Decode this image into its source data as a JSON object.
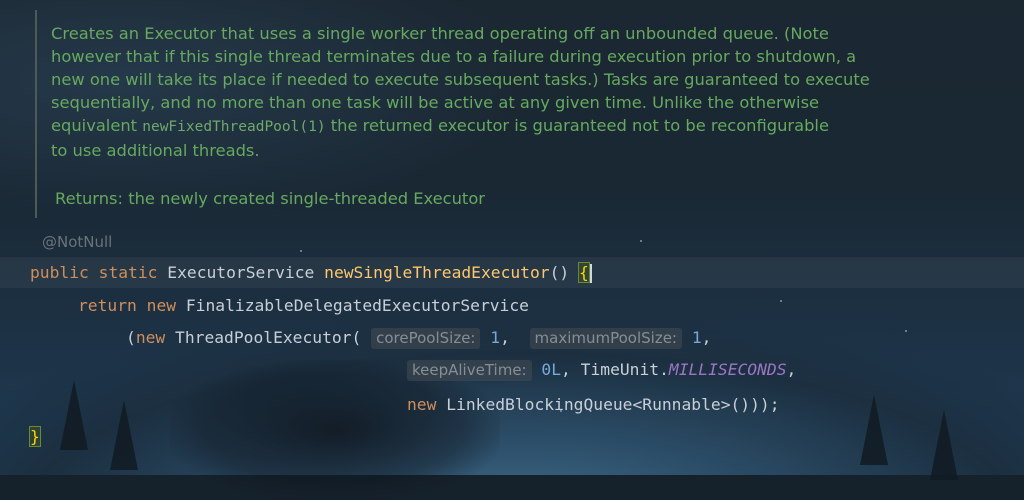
{
  "doc": {
    "lines": [
      "Creates an Executor that uses a single worker thread operating off an unbounded queue. (Note",
      "however that if this single thread terminates due to a failure during execution prior to shutdown, a",
      "new one will take its place if needed to execute subsequent tasks.) Tasks are guaranteed to execute",
      "sequentially, and no more than one task will be active at any given time. Unlike the otherwise"
    ],
    "line5_pre": "equivalent ",
    "line5_code": "newFixedThreadPool(1)",
    "line5_post": " the returned executor is guaranteed not to be reconfigurable",
    "line6": "to use additional threads.",
    "returns_label": "Returns:",
    "returns_text": "the newly created single-threaded Executor"
  },
  "code": {
    "annotation": "@NotNull",
    "l1": {
      "kw_public": "public",
      "kw_static": "static",
      "return_type": "ExecutorService",
      "method_name": "newSingleThreadExecutor",
      "parens": "()",
      "open_brace": "{"
    },
    "l2": {
      "kw_return": "return",
      "kw_new": "new",
      "type": "FinalizableDelegatedExecutorService"
    },
    "l3": {
      "open_paren": "(",
      "kw_new": "new",
      "type": "ThreadPoolExecutor(",
      "hint_core": "corePoolSize:",
      "val_core": "1",
      "comma1": ",",
      "hint_max": "maximumPoolSize:",
      "val_max": "1",
      "comma2": ","
    },
    "l4": {
      "hint_keep": "keepAliveTime:",
      "val_keep": "0L",
      "comma1": ",",
      "timeunit": "TimeUnit.",
      "const": "MILLISECONDS",
      "comma2": ","
    },
    "l5": {
      "kw_new": "new",
      "rest": "LinkedBlockingQueue<Runnable>()));"
    },
    "close_brace": "}"
  },
  "colors": {
    "doc_text": "#66a95f",
    "keyword": "#cf8e5c",
    "method": "#ffc66d",
    "number": "#7aa7d6",
    "constant": "#9d76c2",
    "plain": "#c9cfd6",
    "hint": "#878d94",
    "brace": "#ffd700"
  }
}
